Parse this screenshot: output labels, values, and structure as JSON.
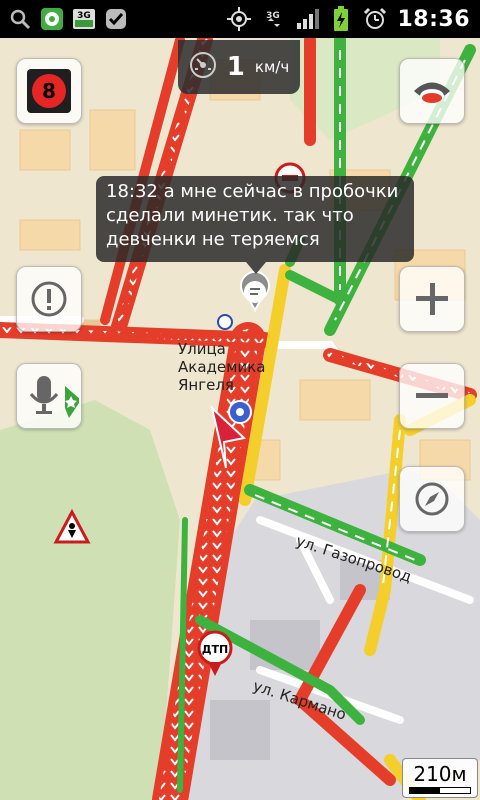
{
  "status_bar": {
    "time": "18:36",
    "network_label": "3G",
    "icons": [
      "search-icon",
      "yandex-maps-icon",
      "3g-icon",
      "check-icon",
      "gps-icon",
      "data-3g-icon",
      "signal-icon",
      "battery-charging-icon",
      "alarm-icon"
    ]
  },
  "speed": {
    "value": "1",
    "unit": "км/ч"
  },
  "traffic": {
    "level": "8"
  },
  "message": {
    "text": "18:32 а мне сейчас в пробочки сделали минетик. так что девченки не теряемся"
  },
  "streets": {
    "academic_1": "Улица",
    "academic_2": "Академика",
    "academic_3": "Янгеля",
    "gazoprovod": "ул. Газопровод",
    "karmanova": "ул. Кармано"
  },
  "markers": {
    "accident_label": "ДТП"
  },
  "scale": {
    "label": "210м"
  },
  "colors": {
    "heavy_traffic": "#e43d2a",
    "medium_traffic": "#f4cf2c",
    "free_traffic": "#3eb23e",
    "map_background": "#efe6cf",
    "park": "#cfe1b4",
    "industrial": "#d9d9dd"
  }
}
